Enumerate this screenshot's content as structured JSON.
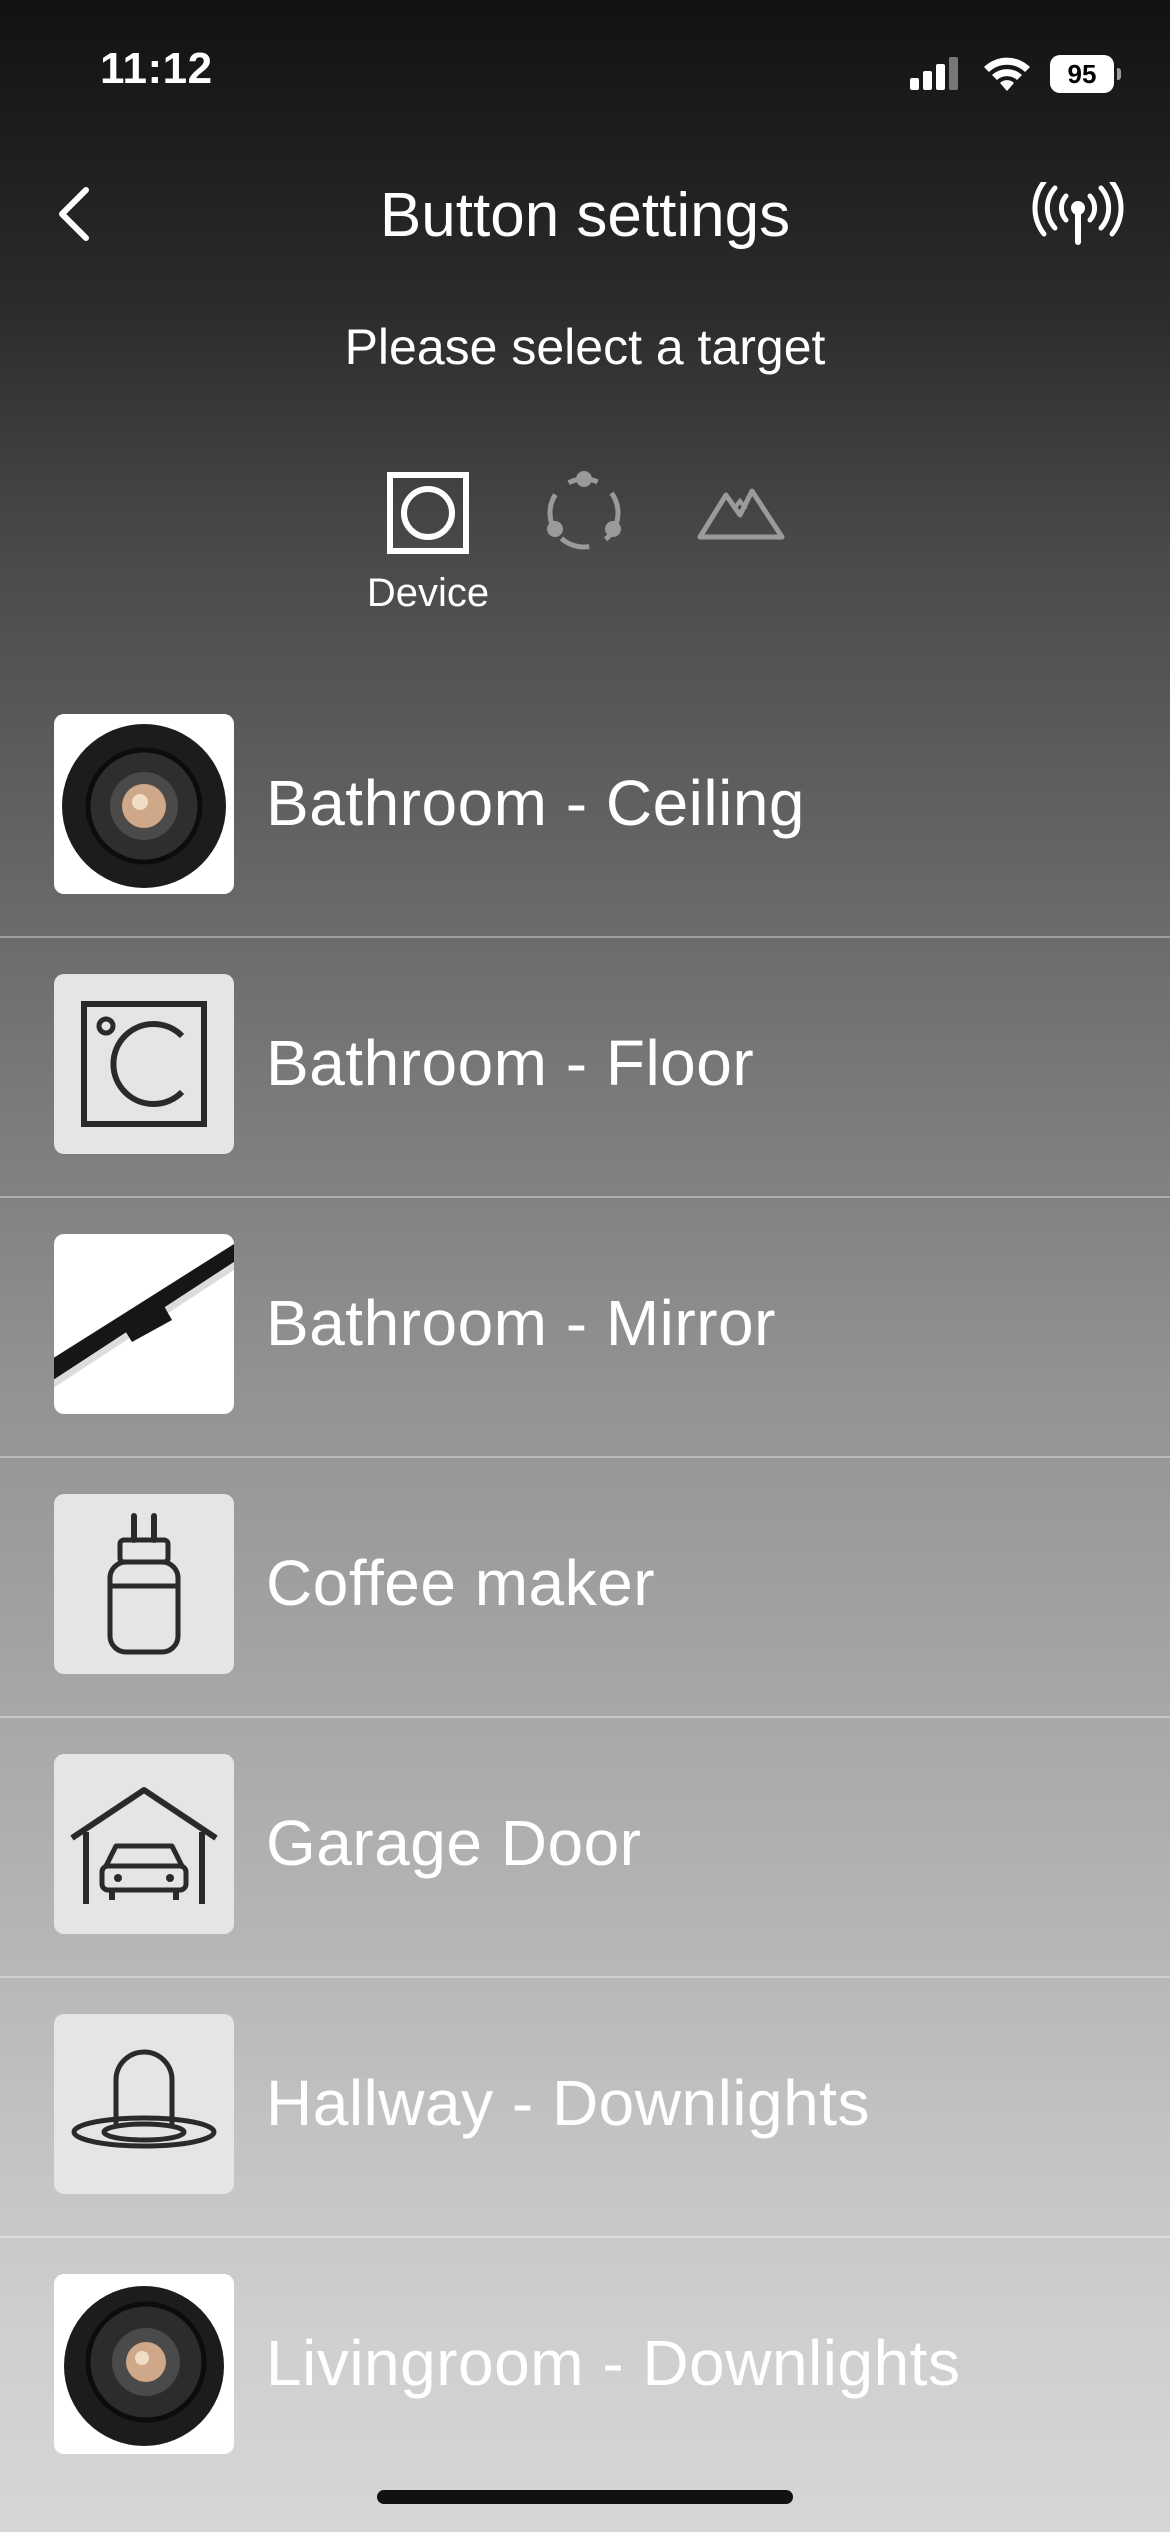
{
  "status_bar": {
    "time": "11:12",
    "battery": "95"
  },
  "header": {
    "title": "Button settings",
    "subtitle": "Please select a target"
  },
  "target_types": [
    {
      "label": "Device",
      "icon": "device-icon",
      "selected": true
    },
    {
      "label": "",
      "icon": "group-icon",
      "selected": false
    },
    {
      "label": "",
      "icon": "scene-icon",
      "selected": false
    }
  ],
  "devices": [
    {
      "label": "Bathroom - Ceiling",
      "icon": "ceiling-downlight-photo"
    },
    {
      "label": "Bathroom - Floor",
      "icon": "floor-heating-icon"
    },
    {
      "label": "Bathroom - Mirror",
      "icon": "mirror-light-photo"
    },
    {
      "label": "Coffee maker",
      "icon": "plug-icon"
    },
    {
      "label": "Garage Door",
      "icon": "garage-icon"
    },
    {
      "label": "Hallway - Downlights",
      "icon": "downlight-icon"
    },
    {
      "label": "Livingroom - Downlights",
      "icon": "downlight-photo"
    }
  ]
}
